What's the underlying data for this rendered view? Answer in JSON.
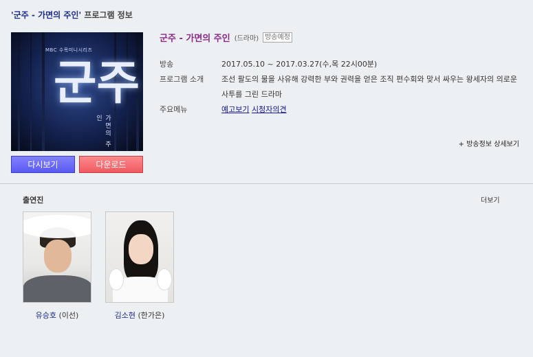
{
  "header": {
    "program_quoted": "'군주 - 가면의 주인'",
    "suffix": " 프로그램 정보"
  },
  "poster": {
    "logo_text": "MBC 수목미니시리즈",
    "calligraphy": "군주",
    "subtitle": "가면의 주인"
  },
  "buttons": {
    "replay": "다시보기",
    "download": "다운로드"
  },
  "program": {
    "title": "군주 - 가면의 주인",
    "genre": "(드라마)",
    "status_badge": "방송예정"
  },
  "info": {
    "broadcast_label": "방송",
    "broadcast_value": "2017.05.10 ~ 2017.03.27(수,목 22시00분)",
    "intro_label": "프로그램 소개",
    "intro_value": "조선 팔도의 물을 사유해 강력한 부와 권력을 얻은 조직 편수회와 맞서 싸우는 왕세자의 의로운 사투를 그린 드라마",
    "menu_label": "주요메뉴",
    "menu_links": [
      "예고보기",
      "시청자의견"
    ]
  },
  "detail_link": "+ 방송정보 상세보기",
  "cast_section": {
    "title": "출연진",
    "more": "더보기",
    "members": [
      {
        "name": "유승호",
        "role": " (이선)"
      },
      {
        "name": "김소현",
        "role": " (한가은)"
      }
    ]
  },
  "colors": {
    "title": "#8a2a8a",
    "link": "#14149c",
    "replay_button": "#6a6af8",
    "download_button": "#f06a70"
  }
}
